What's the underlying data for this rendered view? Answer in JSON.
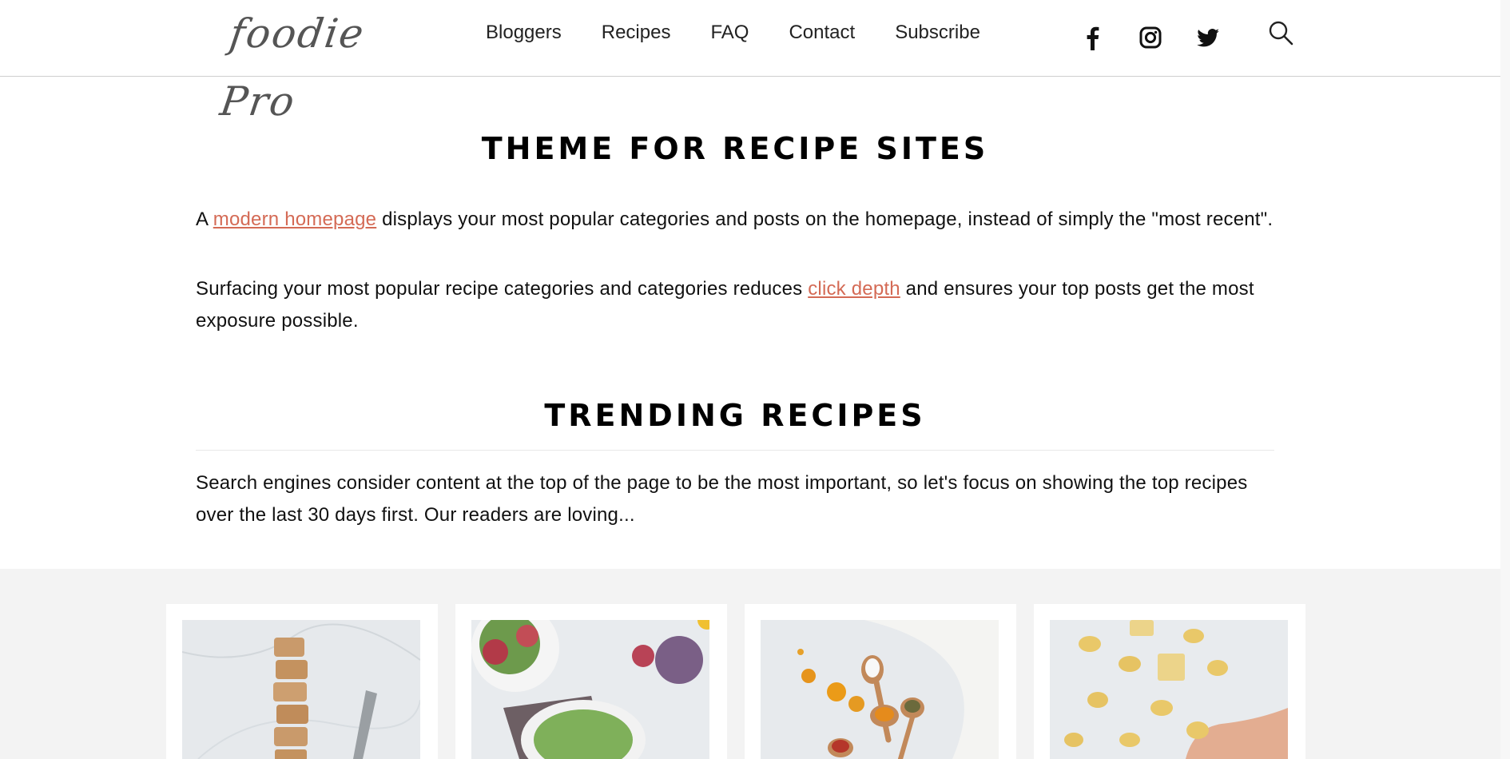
{
  "header": {
    "logo_text": "foodie Pro",
    "nav": [
      "Bloggers",
      "Recipes",
      "FAQ",
      "Contact",
      "Subscribe"
    ],
    "social_icons": [
      "facebook-icon",
      "instagram-icon",
      "twitter-icon"
    ],
    "search_icon": "search-icon"
  },
  "intro": {
    "title": "THEME FOR RECIPE SITES",
    "p1_before": "A ",
    "p1_link": "modern homepage",
    "p1_after": " displays your most popular categories and posts on the homepage, instead of simply the \"most recent\".",
    "p2_before": "Surfacing your most popular recipe categories and categories reduces ",
    "p2_link": "click depth",
    "p2_after": " and ensures your top posts get the most exposure possible."
  },
  "trending": {
    "title": "TRENDING RECIPES",
    "description": "Search engines consider content at the top of the page to be the most important, so let's focus on showing the top recipes over the last 30 days first. Our readers are loving..."
  },
  "cards": [
    {
      "image": "granola-bars-photo"
    },
    {
      "image": "salad-figs-photo"
    },
    {
      "image": "spices-spoons-photo"
    },
    {
      "image": "pasta-tortellini-photo"
    }
  ],
  "colors": {
    "link": "#d46a55",
    "band": "#f3f3f3",
    "text": "#111111"
  }
}
